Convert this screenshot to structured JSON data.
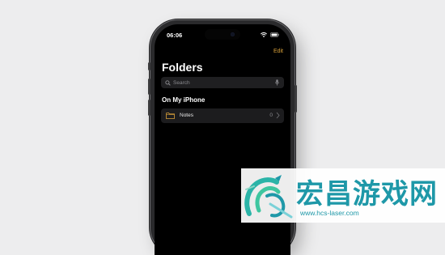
{
  "status_bar": {
    "time": "06:06"
  },
  "notes_app": {
    "edit_label": "Edit",
    "title": "Folders",
    "search": {
      "placeholder": "Search"
    },
    "section_title": "On My iPhone",
    "folders": [
      {
        "name": "Notes",
        "count": "0"
      }
    ]
  },
  "watermark": {
    "brand": "宏昌游戏网",
    "url": "www.hcs-laser.com"
  },
  "colors": {
    "accent": "#d8a03a",
    "screen_bg": "#000000",
    "row_bg": "#1c1c1e",
    "watermark": "#1e98a8"
  },
  "icons": [
    "search-icon",
    "microphone-icon",
    "folder-icon",
    "chevron-right-icon",
    "wifi-icon",
    "battery-icon",
    "cellular-signal-icon"
  ]
}
